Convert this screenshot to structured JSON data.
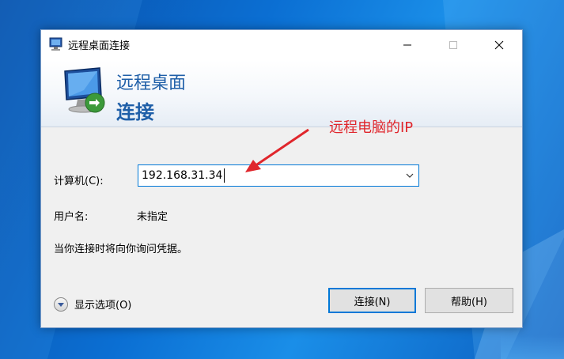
{
  "window": {
    "title": "远程桌面连接",
    "controls": {
      "minimize_icon": "minimize-icon",
      "maximize_icon": "maximize-icon",
      "close_icon": "close-icon"
    }
  },
  "banner": {
    "line1": "远程桌面",
    "line2": "连接",
    "icon": "remote-desktop-monitor-icon"
  },
  "annotation": {
    "text": "远程电脑的IP",
    "color": "#e0262c"
  },
  "form": {
    "computer_label": "计算机(C):",
    "computer_value": "192.168.31.34",
    "username_label": "用户名:",
    "username_value": "未指定",
    "info_text": "当你连接时将向你询问凭据。"
  },
  "footer": {
    "options_label": "显示选项(O)",
    "connect_button": "连接(N)",
    "help_button": "帮助(H)"
  },
  "colors": {
    "accent": "#0078d7",
    "banner_text": "#1f5fa8",
    "desktop": "#0b6fd3"
  }
}
